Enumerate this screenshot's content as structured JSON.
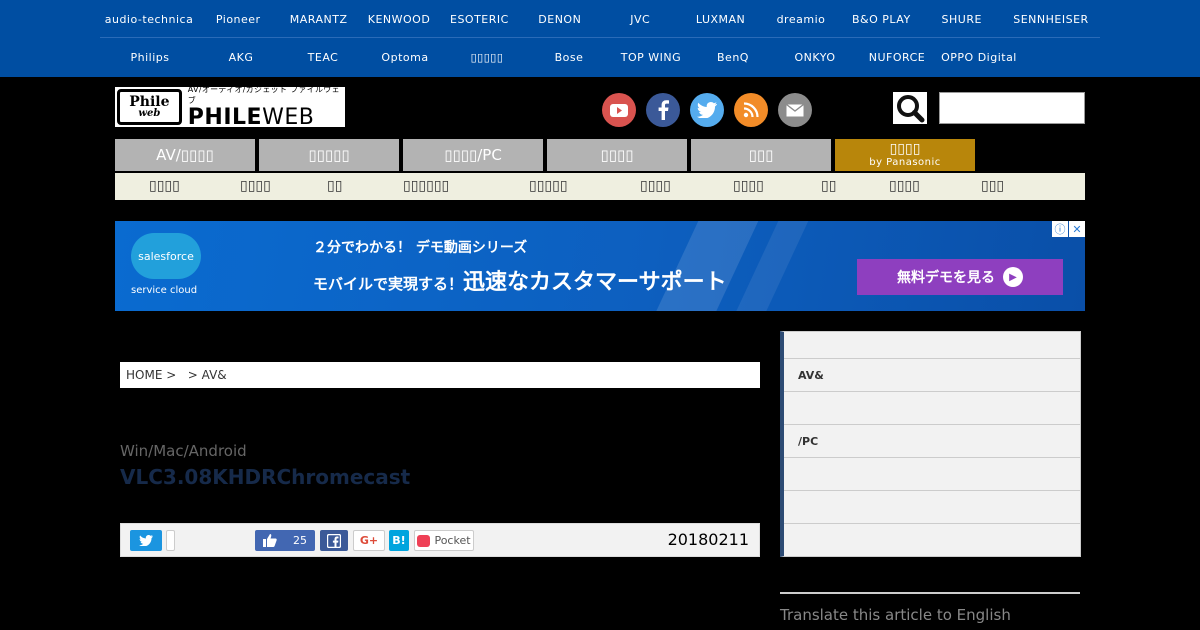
{
  "brands_row1": [
    "audio-technica",
    "Pioneer",
    "MARANTZ",
    "KENWOOD",
    "ESOTERIC",
    "DENON",
    "JVC",
    "LUXMAN",
    "dreamio",
    "B&O PLAY",
    "SHURE",
    "SENNHEISER"
  ],
  "brands_row2": [
    "Philips",
    "AKG",
    "TEAC",
    "Optoma",
    "▯▯▯▯▯",
    "Bose",
    "TOP WING",
    "BenQ",
    "ONKYO",
    "NUFORCE",
    "OPPO Digital"
  ],
  "logo": {
    "badge_top": "Phile",
    "badge_bottom": "web",
    "tagline": "AV/オーディオ/ガジェット ファイルウェブ",
    "wordmark_bold": "PHILE",
    "wordmark_light": "WEB"
  },
  "nav_tabs": [
    "AV/▯▯▯▯",
    "▯▯▯▯▯",
    "▯▯▯▯/PC",
    "▯▯▯▯",
    "▯▯▯"
  ],
  "nav_tab_special": {
    "label": "▯▯▯▯",
    "sub": "by Panasonic"
  },
  "subnav": [
    "▯▯▯▯",
    "▯▯▯▯",
    "▯▯",
    "▯▯▯▯▯▯",
    "▯▯▯▯▯",
    "▯▯▯▯",
    "▯▯▯▯",
    "▯▯",
    "▯▯▯▯",
    "▯▯▯"
  ],
  "ad": {
    "brand": "salesforce",
    "brand_sub": "service cloud",
    "line1": "２分でわかる！ デモ動画シリーズ",
    "line2_small": "モバイルで実現する！",
    "line2_big": "迅速なカスタマーサポート",
    "cta": "無料デモを見る",
    "info": "ⓘ",
    "close": "✕"
  },
  "breadcrumb": {
    "home": "HOME",
    "sep1": ">",
    "sep2": ">",
    "current": "AV&"
  },
  "article": {
    "subtitle": "Win/Mac/Android",
    "title": "VLC3.08KHDRChromecast",
    "date": "20180211"
  },
  "share": {
    "like_count": "25",
    "gplus": "G+",
    "hatena": "B!",
    "pocket": "Pocket"
  },
  "sidebar": [
    "",
    "AV&",
    "",
    "/PC",
    "",
    "",
    ""
  ],
  "translate": "Translate this article to English"
}
